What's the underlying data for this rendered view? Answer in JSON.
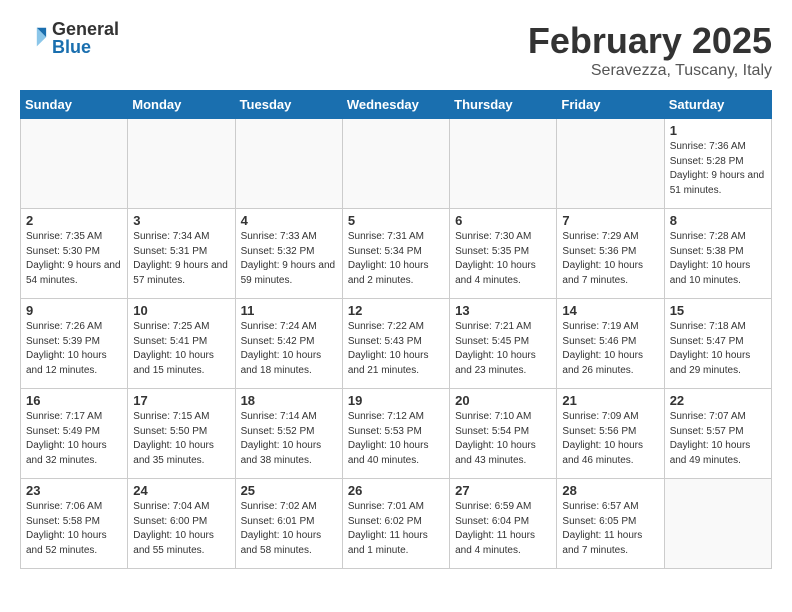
{
  "header": {
    "logo_general": "General",
    "logo_blue": "Blue",
    "title": "February 2025",
    "subtitle": "Seravezza, Tuscany, Italy"
  },
  "weekdays": [
    "Sunday",
    "Monday",
    "Tuesday",
    "Wednesday",
    "Thursday",
    "Friday",
    "Saturday"
  ],
  "weeks": [
    [
      {
        "day": "",
        "info": ""
      },
      {
        "day": "",
        "info": ""
      },
      {
        "day": "",
        "info": ""
      },
      {
        "day": "",
        "info": ""
      },
      {
        "day": "",
        "info": ""
      },
      {
        "day": "",
        "info": ""
      },
      {
        "day": "1",
        "info": "Sunrise: 7:36 AM\nSunset: 5:28 PM\nDaylight: 9 hours and 51 minutes."
      }
    ],
    [
      {
        "day": "2",
        "info": "Sunrise: 7:35 AM\nSunset: 5:30 PM\nDaylight: 9 hours and 54 minutes."
      },
      {
        "day": "3",
        "info": "Sunrise: 7:34 AM\nSunset: 5:31 PM\nDaylight: 9 hours and 57 minutes."
      },
      {
        "day": "4",
        "info": "Sunrise: 7:33 AM\nSunset: 5:32 PM\nDaylight: 9 hours and 59 minutes."
      },
      {
        "day": "5",
        "info": "Sunrise: 7:31 AM\nSunset: 5:34 PM\nDaylight: 10 hours and 2 minutes."
      },
      {
        "day": "6",
        "info": "Sunrise: 7:30 AM\nSunset: 5:35 PM\nDaylight: 10 hours and 4 minutes."
      },
      {
        "day": "7",
        "info": "Sunrise: 7:29 AM\nSunset: 5:36 PM\nDaylight: 10 hours and 7 minutes."
      },
      {
        "day": "8",
        "info": "Sunrise: 7:28 AM\nSunset: 5:38 PM\nDaylight: 10 hours and 10 minutes."
      }
    ],
    [
      {
        "day": "9",
        "info": "Sunrise: 7:26 AM\nSunset: 5:39 PM\nDaylight: 10 hours and 12 minutes."
      },
      {
        "day": "10",
        "info": "Sunrise: 7:25 AM\nSunset: 5:41 PM\nDaylight: 10 hours and 15 minutes."
      },
      {
        "day": "11",
        "info": "Sunrise: 7:24 AM\nSunset: 5:42 PM\nDaylight: 10 hours and 18 minutes."
      },
      {
        "day": "12",
        "info": "Sunrise: 7:22 AM\nSunset: 5:43 PM\nDaylight: 10 hours and 21 minutes."
      },
      {
        "day": "13",
        "info": "Sunrise: 7:21 AM\nSunset: 5:45 PM\nDaylight: 10 hours and 23 minutes."
      },
      {
        "day": "14",
        "info": "Sunrise: 7:19 AM\nSunset: 5:46 PM\nDaylight: 10 hours and 26 minutes."
      },
      {
        "day": "15",
        "info": "Sunrise: 7:18 AM\nSunset: 5:47 PM\nDaylight: 10 hours and 29 minutes."
      }
    ],
    [
      {
        "day": "16",
        "info": "Sunrise: 7:17 AM\nSunset: 5:49 PM\nDaylight: 10 hours and 32 minutes."
      },
      {
        "day": "17",
        "info": "Sunrise: 7:15 AM\nSunset: 5:50 PM\nDaylight: 10 hours and 35 minutes."
      },
      {
        "day": "18",
        "info": "Sunrise: 7:14 AM\nSunset: 5:52 PM\nDaylight: 10 hours and 38 minutes."
      },
      {
        "day": "19",
        "info": "Sunrise: 7:12 AM\nSunset: 5:53 PM\nDaylight: 10 hours and 40 minutes."
      },
      {
        "day": "20",
        "info": "Sunrise: 7:10 AM\nSunset: 5:54 PM\nDaylight: 10 hours and 43 minutes."
      },
      {
        "day": "21",
        "info": "Sunrise: 7:09 AM\nSunset: 5:56 PM\nDaylight: 10 hours and 46 minutes."
      },
      {
        "day": "22",
        "info": "Sunrise: 7:07 AM\nSunset: 5:57 PM\nDaylight: 10 hours and 49 minutes."
      }
    ],
    [
      {
        "day": "23",
        "info": "Sunrise: 7:06 AM\nSunset: 5:58 PM\nDaylight: 10 hours and 52 minutes."
      },
      {
        "day": "24",
        "info": "Sunrise: 7:04 AM\nSunset: 6:00 PM\nDaylight: 10 hours and 55 minutes."
      },
      {
        "day": "25",
        "info": "Sunrise: 7:02 AM\nSunset: 6:01 PM\nDaylight: 10 hours and 58 minutes."
      },
      {
        "day": "26",
        "info": "Sunrise: 7:01 AM\nSunset: 6:02 PM\nDaylight: 11 hours and 1 minute."
      },
      {
        "day": "27",
        "info": "Sunrise: 6:59 AM\nSunset: 6:04 PM\nDaylight: 11 hours and 4 minutes."
      },
      {
        "day": "28",
        "info": "Sunrise: 6:57 AM\nSunset: 6:05 PM\nDaylight: 11 hours and 7 minutes."
      },
      {
        "day": "",
        "info": ""
      }
    ]
  ]
}
